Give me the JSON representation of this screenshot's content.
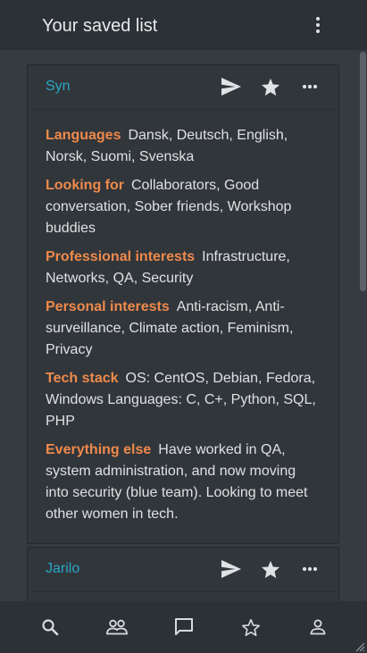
{
  "topbar": {
    "title": "Your saved list",
    "menu_icon": "more-vertical-icon"
  },
  "cards": [
    {
      "name": "Syn",
      "actions": [
        "send-icon",
        "star-icon",
        "more-horizontal-icon"
      ],
      "fields": [
        {
          "label": "Languages",
          "value": "Dansk, Deutsch, English, Norsk, Suomi, Svenska"
        },
        {
          "label": "Looking for",
          "value": "Collaborators, Good conversation, Sober friends, Workshop buddies"
        },
        {
          "label": "Professional interests",
          "value": "Infrastructure, Networks, QA, Security"
        },
        {
          "label": "Personal interests",
          "value": "Anti-racism, Anti-surveillance, Climate action, Feminism, Privacy"
        },
        {
          "label": "Tech stack",
          "value": "OS: CentOS, Debian, Fedora, Windows Languages: C, C+, Python, SQL, PHP"
        },
        {
          "label": "Everything else",
          "value": "Have worked in QA, system administration, and now moving into security (blue team). Looking to meet other women in tech."
        }
      ]
    },
    {
      "name": "Jarilo",
      "actions": [
        "send-icon",
        "star-icon",
        "more-horizontal-icon"
      ],
      "fields": []
    }
  ],
  "bottom_nav": [
    "search-icon",
    "people-icon",
    "chat-icon",
    "star-outline-icon",
    "person-icon"
  ],
  "colors": {
    "background": "#353b40",
    "bar": "#2c3136",
    "card": "#31363b",
    "name_link": "#2aa6c7",
    "field_label": "#ef8a4b",
    "text": "#dfe1e3"
  }
}
